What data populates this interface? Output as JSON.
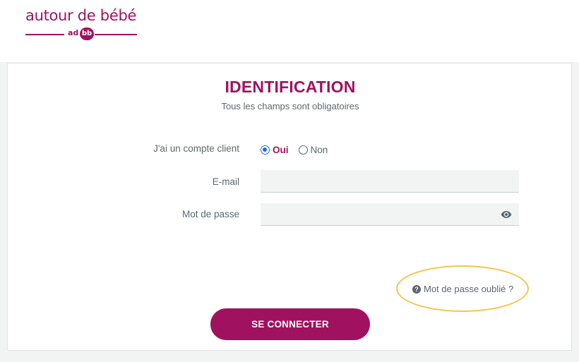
{
  "brand": {
    "name": "autour de bébé",
    "sub_left": "ad",
    "sub_right": "bb",
    "color": "#a0125f"
  },
  "form": {
    "title": "IDENTIFICATION",
    "subtitle": "Tous les champs sont obligatoires",
    "account_label": "J'ai un compte client",
    "account_options": [
      {
        "label": "Oui",
        "checked": true
      },
      {
        "label": "Non",
        "checked": false
      }
    ],
    "email_label": "E-mail",
    "email_value": "",
    "password_label": "Mot de passe",
    "password_value": "",
    "password_toggle_icon": "eye-icon",
    "forgot_icon": "question-circle-icon",
    "forgot_label": "Mot de passe oublié ?",
    "forgot_highlight_color": "#f2c64a",
    "submit_label": "SE CONNECTER"
  }
}
